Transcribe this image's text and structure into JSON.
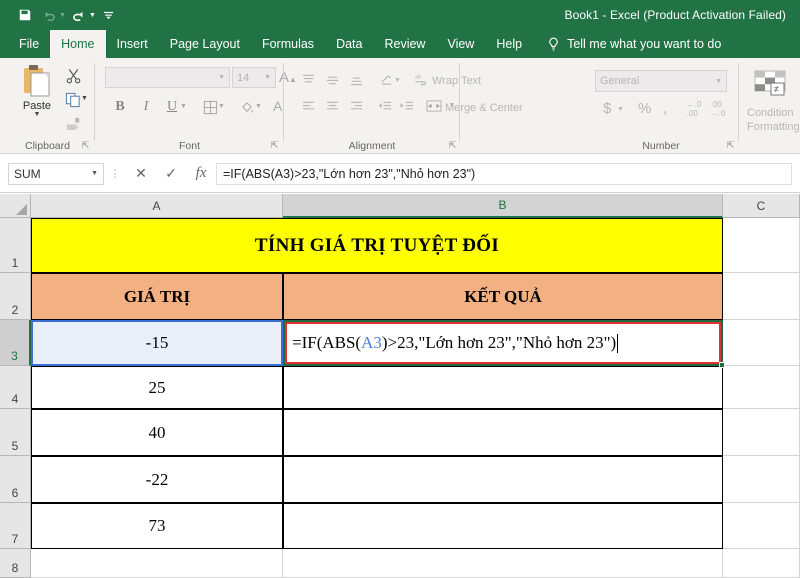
{
  "window": {
    "title": "Book1  -  Excel (Product Activation Failed)",
    "accent_color": "#217346"
  },
  "quick_access": {
    "items": [
      {
        "name": "save-icon",
        "label": "Save",
        "enabled": true
      },
      {
        "name": "undo-icon",
        "label": "Undo",
        "enabled": false
      },
      {
        "name": "redo-icon",
        "label": "Redo",
        "enabled": true
      },
      {
        "name": "customize-qat-icon",
        "label": "Customize Quick Access Toolbar",
        "enabled": true
      }
    ]
  },
  "ribbon": {
    "tabs": [
      {
        "label": "File",
        "active": false
      },
      {
        "label": "Home",
        "active": true
      },
      {
        "label": "Insert",
        "active": false
      },
      {
        "label": "Page Layout",
        "active": false
      },
      {
        "label": "Formulas",
        "active": false
      },
      {
        "label": "Data",
        "active": false
      },
      {
        "label": "Review",
        "active": false
      },
      {
        "label": "View",
        "active": false
      },
      {
        "label": "Help",
        "active": false
      }
    ],
    "tell_me": "Tell me what you want to do",
    "groups": [
      {
        "label": "Clipboard"
      },
      {
        "label": "Font"
      },
      {
        "label": "Alignment"
      },
      {
        "label": "Number"
      }
    ],
    "clipboard": {
      "paste_label": "Paste",
      "cut_label": "Cut",
      "copy_label": "Copy",
      "format_painter_label": "Format Painter"
    },
    "font": {
      "font_name": "",
      "font_size": "14",
      "grow_label": "A",
      "shrink_label": "A",
      "bold_label": "B",
      "italic_label": "I",
      "underline_label": "U",
      "borders_label": "Borders",
      "fill_label": "Fill Color",
      "fontcolor_label": "A"
    },
    "alignment": {
      "wrap_text_label": "Wrap Text",
      "merge_center_label": "Merge & Center"
    },
    "number": {
      "format_value": "General",
      "currency_label": "$",
      "percent_label": "%",
      "comma_label": ",",
      "inc_decimal_label": ".00",
      "dec_decimal_label": ".00"
    },
    "styles": {
      "conditional_formatting_label": "Condition\nFormatting"
    }
  },
  "formula_bar": {
    "name_box_value": "SUM",
    "cancel_label": "✕",
    "enter_label": "✓",
    "fx_label": "fx",
    "formula": "=IF(ABS(A3)>23,\"Lớn hơn 23\",\"Nhỏ hơn 23\")",
    "formula_prefix": "=IF(ABS(",
    "formula_ref": "A3",
    "formula_suffix": ")>23,\"Lớn hơn 23\",\"Nhỏ hơn 23\")"
  },
  "sheet": {
    "columns": [
      {
        "label": "A",
        "selected": false
      },
      {
        "label": "B",
        "selected": true
      },
      {
        "label": "C",
        "selected": false
      }
    ],
    "rows": [
      {
        "label": "1",
        "selected": false
      },
      {
        "label": "2",
        "selected": false
      },
      {
        "label": "3",
        "selected": true
      },
      {
        "label": "4",
        "selected": false
      },
      {
        "label": "5",
        "selected": false
      },
      {
        "label": "6",
        "selected": false
      },
      {
        "label": "7",
        "selected": false
      },
      {
        "label": "8",
        "selected": false
      }
    ],
    "title_cell": "TÍNH GIÁ TRỊ TUYỆT ĐỐI",
    "header_a": "GIÁ TRỊ",
    "header_b": "KẾT QUẢ",
    "values_a": [
      "-15",
      "25",
      "40",
      "-22",
      "73"
    ],
    "active_cell": "B3",
    "colors": {
      "title_fill": "#ffff00",
      "header_fill": "#f2b083",
      "reference_highlight": "#e8eff9",
      "edit_border": "#e03030",
      "selection_border": "#1e6b40",
      "reference_border": "#3b6fd4"
    }
  }
}
